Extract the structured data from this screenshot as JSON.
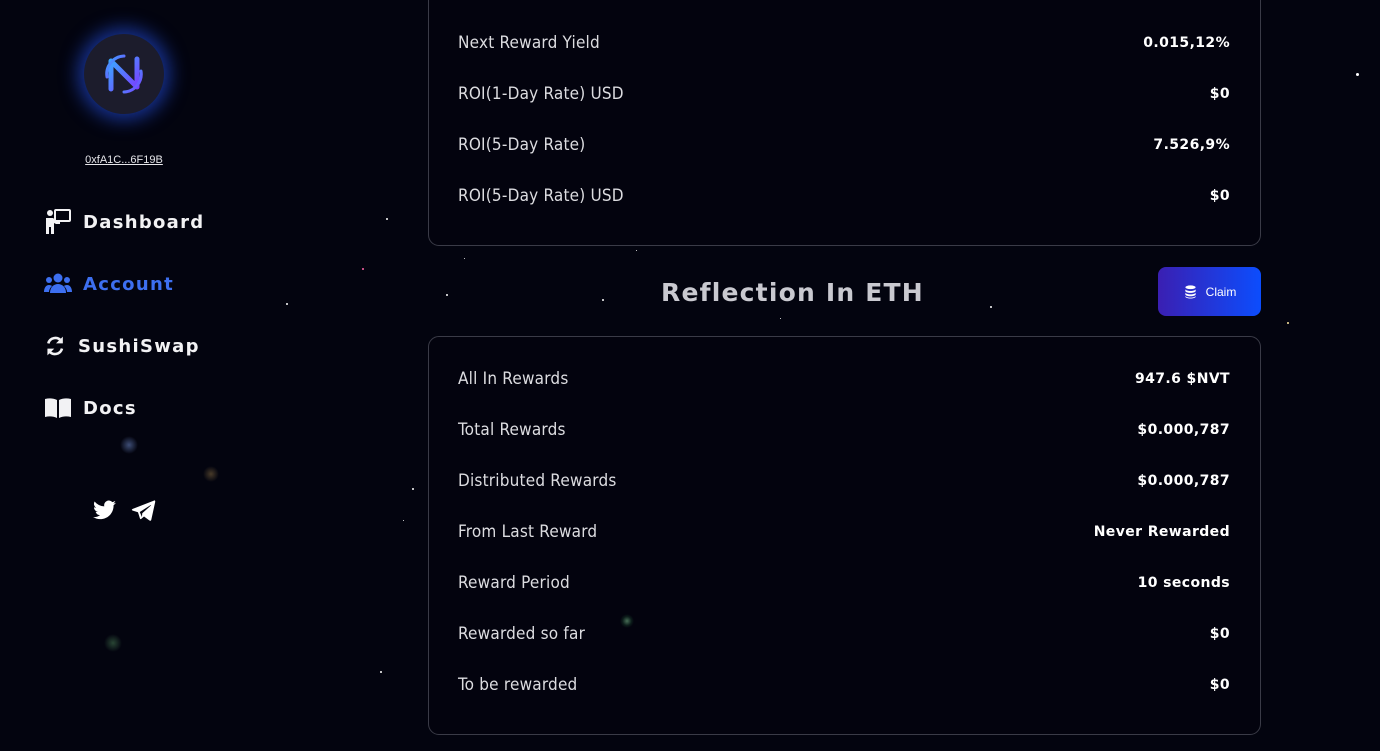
{
  "wallet": {
    "address": "0xfA1C...6F19B"
  },
  "nav": {
    "dashboard": "Dashboard",
    "account": "Account",
    "sushiswap": "SushiSwap",
    "docs": "Docs"
  },
  "accent_color": "#3d6ff0",
  "top_stats": [
    {
      "label": "Next Reward Yield",
      "value": "0.015,12%"
    },
    {
      "label": "ROI(1-Day Rate) USD",
      "value": "$0"
    },
    {
      "label": "ROI(5-Day Rate)",
      "value": "7.526,9%"
    },
    {
      "label": "ROI(5-Day Rate) USD",
      "value": "$0"
    }
  ],
  "reflection": {
    "title": "Reflection In ETH",
    "claim_label": "Claim",
    "rows": [
      {
        "label": "All In Rewards",
        "value": "947.6 $NVT"
      },
      {
        "label": "Total Rewards",
        "value": "$0.000,787"
      },
      {
        "label": "Distributed Rewards",
        "value": "$0.000,787"
      },
      {
        "label": "From Last Reward",
        "value": "Never Rewarded"
      },
      {
        "label": "Reward Period",
        "value": "10 seconds"
      },
      {
        "label": "Rewarded so far",
        "value": "$0"
      },
      {
        "label": "To be rewarded",
        "value": "$0"
      }
    ]
  }
}
